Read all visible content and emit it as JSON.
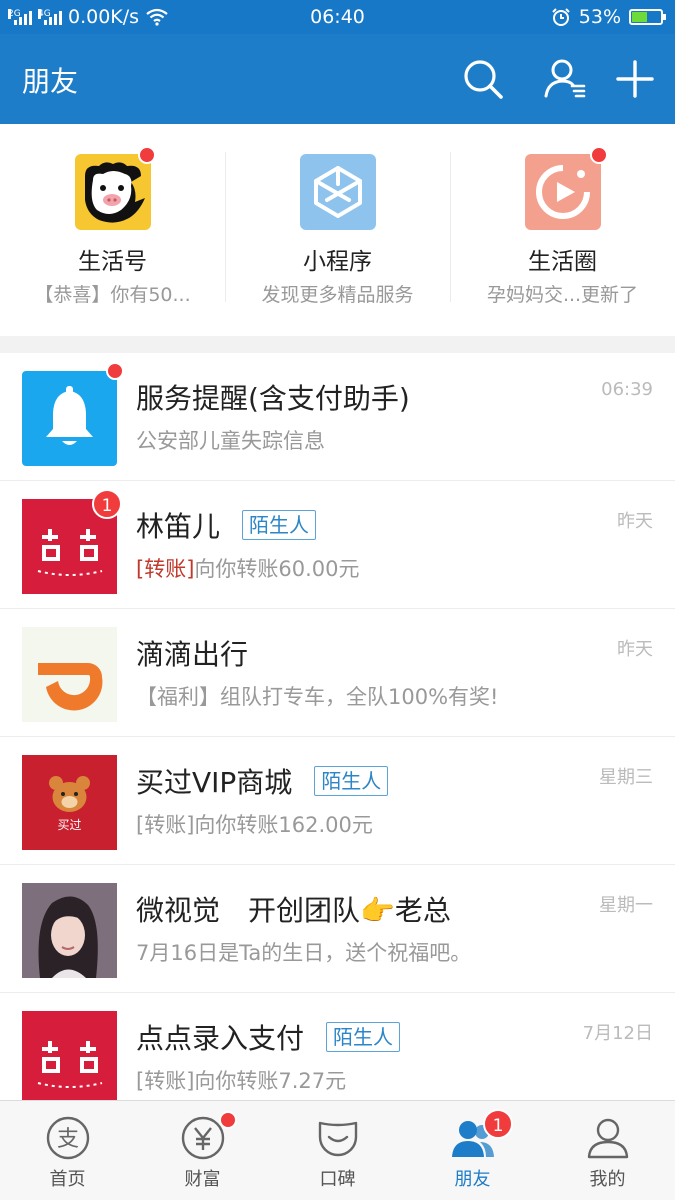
{
  "status_bar": {
    "net_type_1": "2G",
    "net_type_2": "4G",
    "speed": "0.00K/s",
    "time": "06:40",
    "battery": "53%",
    "battery_level": 0.53
  },
  "header": {
    "title": "朋友"
  },
  "tiles": [
    {
      "title": "生活号",
      "subtitle": "【恭喜】你有50...",
      "has_dot": true
    },
    {
      "title": "小程序",
      "subtitle": "发现更多精品服务",
      "has_dot": false
    },
    {
      "title": "生活圈",
      "subtitle": "孕妈妈交...更新了",
      "has_dot": true
    }
  ],
  "conversations": [
    {
      "name": "服务提醒(含支付助手)",
      "tag": "",
      "preview_prefix": "",
      "preview": "公安部儿童失踪信息",
      "time": "06:39",
      "indicator": "dot",
      "badge": ""
    },
    {
      "name": "林笛儿",
      "tag": "陌生人",
      "preview_prefix": "[转账]",
      "preview": "向你转账60.00元",
      "time": "昨天",
      "indicator": "badge",
      "badge": "1"
    },
    {
      "name": "滴滴出行",
      "tag": "",
      "preview_prefix": "",
      "preview": "【福利】组队打专车，全队100%有奖!",
      "time": "昨天",
      "indicator": "",
      "badge": ""
    },
    {
      "name": "买过VIP商城",
      "tag": "陌生人",
      "preview_prefix": "",
      "preview": "[转账]向你转账162.00元",
      "time": "星期三",
      "indicator": "",
      "badge": "",
      "avatar_text": "买过"
    },
    {
      "name": "微视觉　开创团队👉老总",
      "tag": "",
      "preview_prefix": "",
      "preview": "7月16日是Ta的生日，送个祝福吧。",
      "time": "星期一",
      "indicator": "",
      "badge": ""
    },
    {
      "name": "点点录入支付",
      "tag": "陌生人",
      "preview_prefix": "",
      "preview": "[转账]向你转账7.27元",
      "time": "7月12日",
      "indicator": "",
      "badge": ""
    }
  ],
  "tabbar": {
    "items": [
      {
        "label": "首页",
        "icon": "home-icon"
      },
      {
        "label": "财富",
        "icon": "wealth-icon",
        "has_dot": true
      },
      {
        "label": "口碑",
        "icon": "koubei-icon"
      },
      {
        "label": "朋友",
        "icon": "friends-icon",
        "active": true,
        "badge": "1"
      },
      {
        "label": "我的",
        "icon": "profile-icon"
      }
    ]
  },
  "colors": {
    "brand_blue": "#1e7dc8",
    "badge_red": "#f03c3c",
    "tag_blue": "#2b86c8"
  }
}
